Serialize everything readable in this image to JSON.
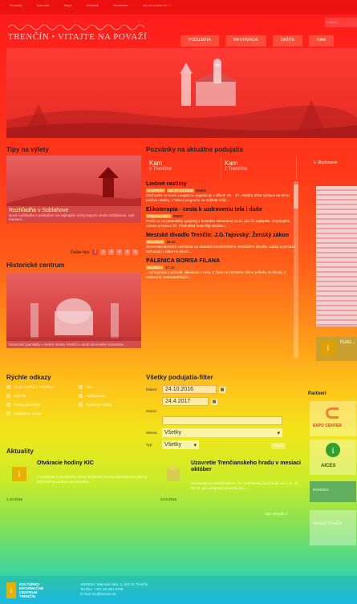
{
  "topbar": {
    "links": [
      "Kontakty",
      "Kalendár",
      "Mapy",
      "Inštitúcie",
      "Newsletter",
      "ako sa dostať do...?"
    ],
    "search_placeholder": "Hľadať..."
  },
  "brand": {
    "title": "TRENČÍN • VITAJTE NA POVAŽÍ"
  },
  "nav": [
    "PODUJATIA",
    "INFORMÁCIE",
    "ZAŽITE",
    "KAM"
  ],
  "tips": {
    "heading": "Tipy na výlety",
    "photo1": {
      "title": "Rozhľadňa v Soblahove",
      "desc": "Nová rozhľadňa s pohľadom na najkrajšie vrchy kopcov okolia Soblahova, nad mestom..."
    },
    "pager_label": "Ďalšie tipy:",
    "pages": [
      "1",
      "2",
      "3",
      "4",
      "5",
      "6"
    ]
  },
  "historic": {
    "heading": "Historické centrum",
    "desc": "Historické pamiatky v centre mesta Trenčín v okolí Mierového námestia..."
  },
  "events": {
    "heading": "Pozvánky na aktuálne podujatia",
    "tabs": [
      {
        "a": "Kam",
        "b": "v Trenčíne"
      },
      {
        "a": "Kam",
        "b": "z Trenčína"
      }
    ],
    "items": [
      {
        "title": "Liečivé rastliny",
        "tags": [
          "VÝSTAVA",
          "DO 27.10.2016"
        ],
        "when": "DNES",
        "desc": "Obchodné centrum Laugaricio organizuje v dňoch 15. - 27. októbra 2016 výstavu na tému Liečivé rastliny. V rámci programu sa môžete tešiť..."
      },
      {
        "title": "Elikoterapia - cesta k uzdraveniu tela i duše",
        "tags": [
          "PREDNÁŠKA"
        ],
        "when": "DNES",
        "desc": "Prečo sa na prednášky spojenej s besedou zameranej na to, ako čo najlepšie, zmysluplne, zdravo a krásne žiť. Prednášať bude filip Strubec..."
      },
      {
        "title": "Mestské divadlo Trenčín: J.G.Tajovský: Ženský zákon",
        "tags": [
          "DIVADLO"
        ],
        "when": "26.10.",
        "desc": "Slovenská klasická veselohra na doskách trenčianskeho mestského divadla. Láska a peniaze rozhodujú v bitke na dvore..."
      },
      {
        "title": "PÁLENICA BORISA FILANA",
        "tags": [
          "BESEDA"
        ],
        "when": "27.10.",
        "desc": "...vyrozpráva v pohodlí, sklenicou v ruke. Z času na zoznáme rôzne príbehy zo života, z rodinných cestovateľských..."
      }
    ]
  },
  "right": {
    "tag": "Ubytovanie",
    "kultura": "Kultú..."
  },
  "quick": {
    "heading": "Rýchle odkazy",
    "links": [
      "Čo je nového v Trenčíne?",
      "Kino",
      "Kam ísť",
      "Reštaurácie",
      "Hotely, penzióny",
      "Turistické služby",
      "Kontaktné miesta"
    ]
  },
  "filter": {
    "heading": "Všetky podujatia-filter",
    "date_label": "Dátum:",
    "from": "24.10.2016",
    "to": "24.4.2017",
    "name_label": "Názov:",
    "place_label": "Miesto:",
    "place_value": "Všetky",
    "type_label": "Typ:",
    "type_value": "Všetky",
    "button": "Hľadaj"
  },
  "partneri": {
    "heading": "Partneri",
    "p1": "EXPO CENTER",
    "p2": "AICES",
    "p3": "DOHODA",
    "p4": "Virtual Trenčín"
  },
  "news": {
    "heading": "Aktuality",
    "items": [
      {
        "title": "Otváracie hodiny KIC",
        "text": "V súvislosti s ukončením letnej turistickej sezóny prechádza Kultúrno-informačné centrum do zimného...",
        "date": "1.10.2016"
      },
      {
        "title": "Uzavretie Trenčianskeho hradu v mesiaci október",
        "text": "Oznamujeme návštevníkom, že Trenčiansky hrad bude od 4.10. do 28.10. pre verejnosť uzavretý pre...",
        "date": "24.9.2016"
      }
    ],
    "more": "Viac aktualít >"
  },
  "footer": {
    "logo_text": "KULTÚRNO INFORMAČNÉ CENTRUM TRENČÍN",
    "address": "ADRESA: Mierové nám. 2, 911 01 Trenčín",
    "phone": "Tel./fax: +421 32 650 4709",
    "email": "E-mail: kic@trencin.sk"
  }
}
